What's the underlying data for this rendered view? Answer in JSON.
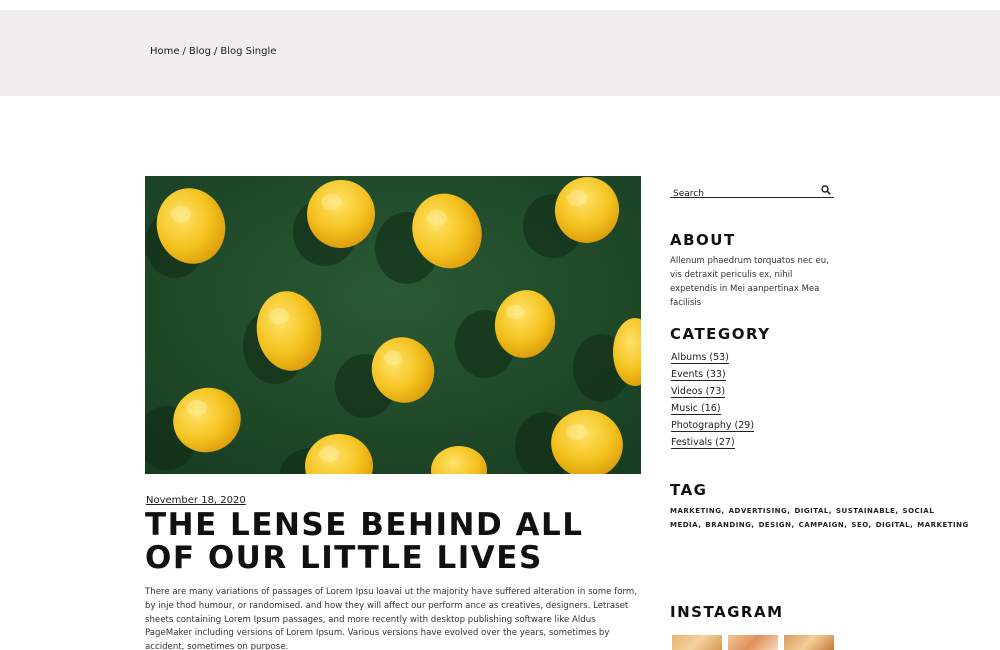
{
  "breadcrumb": {
    "items": [
      "Home",
      "Blog",
      "Blog Single"
    ],
    "separator": "/"
  },
  "post": {
    "date": "November 18, 2020",
    "title_line1": "THE LENSE BEHIND ALL",
    "title_line2": "OF OUR LITTLE LIVES",
    "body": "There are many variations of passages of Lorem Ipsu loavai ut the majority have suffered alteration in some form, by inje thod humour, or randomised. and how they will affect our perform ance as creatives, designers. Letraset sheets containing Lorem Ipsum passages, and more recently with desktop publishing software like Aldus PageMaker including versions of Lorem Ipsum. Various versions have evolved over the years, sometimes by accident, sometimes on purpose."
  },
  "search": {
    "placeholder": "Search"
  },
  "about": {
    "title": "ABOUT",
    "text": "Allenum phaedrum torquatos nec eu, vis detraxit periculis ex, nihil expetendis in Mei aanpertinax Mea facilisis"
  },
  "category": {
    "title": "CATEGORY",
    "items": [
      {
        "label": "Albums (53)"
      },
      {
        "label": "Events  (33)"
      },
      {
        "label": "Videos (73)"
      },
      {
        "label": "Music (16)"
      },
      {
        "label": "Photography (29)"
      },
      {
        "label": "Festivals (27)"
      }
    ]
  },
  "tag": {
    "title": "TAG",
    "items": [
      "MARKETING",
      "ADVERTISING",
      "DIGITAL",
      "SUSTAINABLE",
      "SOCIAL MEDIA",
      "BRANDING",
      "DESIGN",
      "CAMPAIGN",
      "SEO",
      "DIGITAL",
      "MARKETING"
    ]
  },
  "instagram": {
    "title": "INSTAGRAM"
  },
  "colors": {
    "banner_bg": "#f0eeee",
    "hero_bg": "#1f4a2a",
    "lemon": "#f4c21e"
  }
}
